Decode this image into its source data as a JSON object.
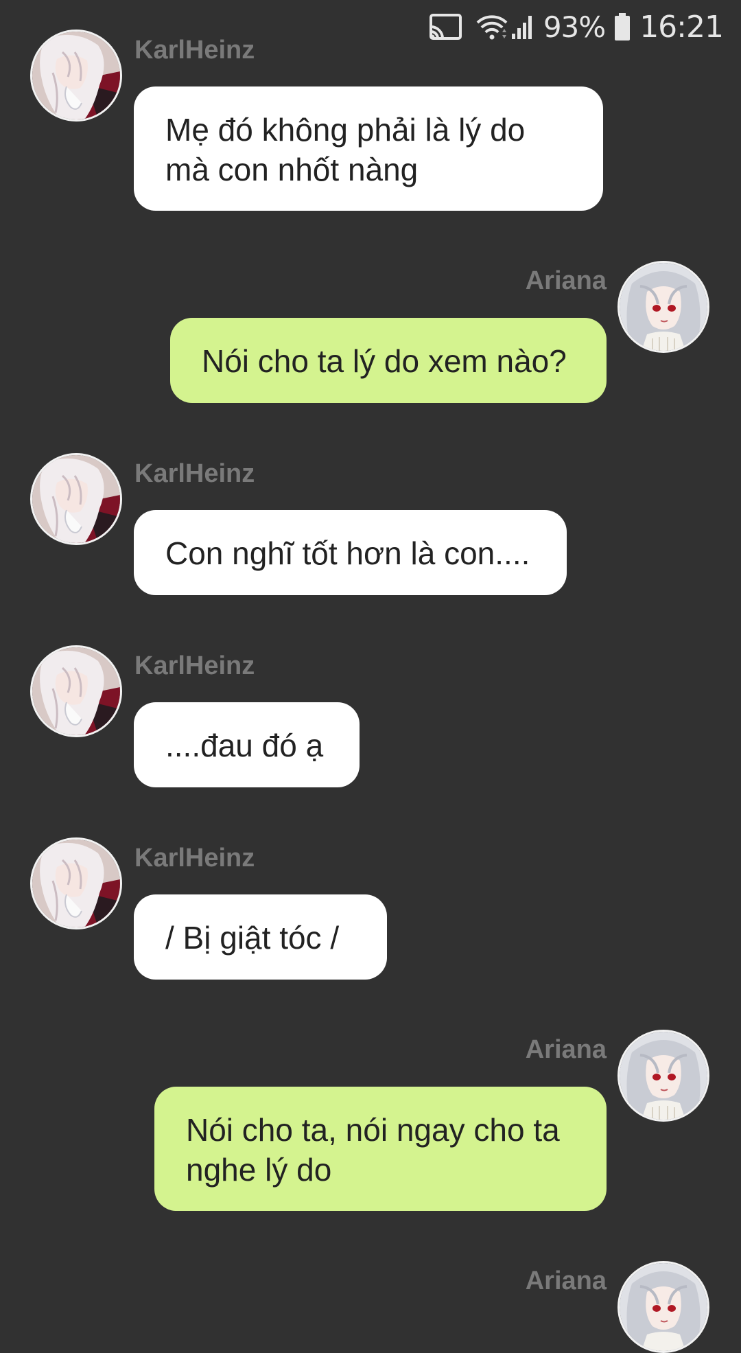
{
  "status_bar": {
    "icons": [
      "cast-icon",
      "wifi-icon",
      "signal-icon",
      "battery-icon"
    ],
    "battery_percent": "93%",
    "time": "16:21"
  },
  "colors": {
    "background": "#313131",
    "incoming_bubble": "#ffffff",
    "outgoing_bubble": "#d4f38f",
    "sender_name": "#7a7a7a"
  },
  "messages": [
    {
      "sender": "KarlHeinz",
      "side": "left",
      "text": "Mẹ đó không phải là lý do\nmà con nhốt nàng"
    },
    {
      "sender": "Ariana",
      "side": "right",
      "text": "Nói cho ta lý do xem nào?"
    },
    {
      "sender": "KarlHeinz",
      "side": "left",
      "text": "Con nghĩ tốt hơn là con...."
    },
    {
      "sender": "KarlHeinz",
      "side": "left",
      "text": "....đau đó ạ"
    },
    {
      "sender": "KarlHeinz",
      "side": "left",
      "text": "/ Bị giật tóc /"
    },
    {
      "sender": "Ariana",
      "side": "right",
      "text": "Nói cho ta, nói ngay cho ta\nnghe lý do"
    },
    {
      "sender": "Ariana",
      "side": "right",
      "text": ""
    }
  ]
}
